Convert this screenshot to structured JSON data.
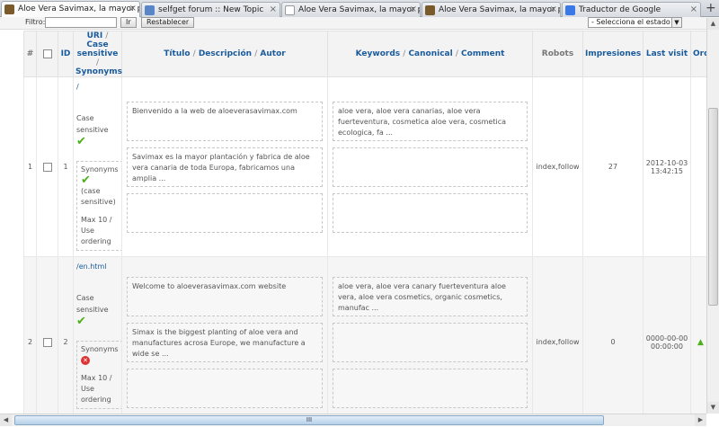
{
  "tabs": [
    {
      "title": "Aloe Vera Savimax, la mayor p...",
      "active": true,
      "icon": "aloe-icon"
    },
    {
      "title": "selfget forum :: New Topic",
      "active": false,
      "icon": "forum-icon"
    },
    {
      "title": "Aloe Vera Savimax, la mayor p...",
      "active": false,
      "icon": "page-icon"
    },
    {
      "title": "Aloe Vera Savimax, la mayor p...",
      "active": false,
      "icon": "aloe-icon"
    },
    {
      "title": "Traductor de Google",
      "active": false,
      "icon": "google-icon"
    }
  ],
  "tab_close": "×",
  "new_tab": "+",
  "filter": {
    "label": "Filtro:",
    "value": "",
    "go_label": "Ir",
    "reset_label": "Restablecer",
    "state_select": "- Selecciona el estado -",
    "select_arrow": "▼"
  },
  "table": {
    "headers": {
      "num": "#",
      "id": "ID",
      "uri_a": "URI",
      "uri_b": "Case sensitive",
      "uri_c": "Synonyms",
      "title_a": "Título",
      "title_b": "Descripción",
      "title_c": "Autor",
      "kw_a": "Keywords",
      "kw_b": "Canonical",
      "kw_c": "Comment",
      "robots": "Robots",
      "impressions": "Impresiones",
      "last_visit": "Last visit",
      "order": "Ord",
      "sep": "/"
    },
    "rows": [
      {
        "num": "1",
        "id": "1",
        "uri": "/",
        "case_label": "Case sensitive",
        "synonyms_label": "Synonyms",
        "synonyms_case": "(case sensitive)",
        "max_line": "Max 10  /  Use ordering",
        "title": "Bienvenido a la web de aloeverasavimax.com",
        "description": "Savimax es la mayor plantación y fabrica de aloe vera canaria de toda Europa, fabricamos una amplia ...",
        "author": "",
        "keywords": "aloe vera, aloe vera canarias, aloe vera fuerteventura, cosmetica aloe vera, cosmetica ecologica, fa ...",
        "canonical": "",
        "comment": "",
        "robots": "index,follow",
        "impressions": "27",
        "last_visit": "2012-10-03 13:42:15"
      },
      {
        "num": "2",
        "id": "2",
        "uri": "/en.html",
        "case_label": "Case sensitive",
        "synonyms_label": "Synonyms",
        "max_line": "Max 10  /  Use ordering",
        "title": "Welcome to aloeverasavimax.com website",
        "description": "Simax is the biggest planting of aloe vera and manufactures acrosa Europe, we manufacture a wide se ...",
        "author": "",
        "keywords": "aloe vera, aloe vera canary fuerteventura aloe vera, aloe vera cosmetics, organic cosmetics, manufac ...",
        "canonical": "",
        "comment": "",
        "robots": "index,follow",
        "impressions": "0",
        "last_visit": "0000-00-00 00:00:00"
      }
    ]
  },
  "icons": {
    "ok": "✔",
    "error": "✕",
    "order_up": "▲"
  },
  "scroll": {
    "up": "▲",
    "down": "▼",
    "left": "◀",
    "right": "▶",
    "grip": "III"
  }
}
